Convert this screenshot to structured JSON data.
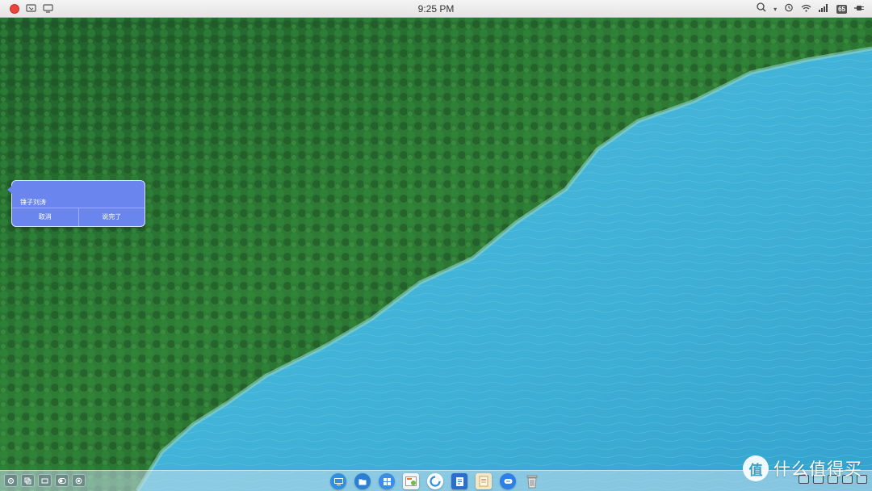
{
  "menubar": {
    "clock": "9:25 PM",
    "battery_label": "65",
    "left_icons": [
      "close-dot-icon",
      "screenshot-icon",
      "display-icon"
    ],
    "right_icons": [
      "search-icon",
      "chevron-down-icon",
      "alarm-icon",
      "wifi-icon",
      "signal-icon",
      "battery-icon",
      "power-plug-icon"
    ]
  },
  "voice_popup": {
    "text": "锤子刘涛",
    "cancel_label": "取消",
    "done_label": "说完了",
    "bg_color": "#6a86ee"
  },
  "dock": {
    "left_tray_icons": [
      "settings-icon",
      "copy-icon",
      "window-icon",
      "toggle-icon",
      "record-icon"
    ],
    "apps": [
      "desktop-app-icon",
      "files-app-icon",
      "grid-apps-icon",
      "gallery-app-icon",
      "browser-app-icon",
      "document-app-icon",
      "notes-app-icon",
      "messages-app-icon",
      "trash-icon"
    ],
    "right_tray_icons": [
      "image-icon",
      "window-icon",
      "stack-icon",
      "list-icon",
      "menu-icon"
    ]
  },
  "watermark": {
    "logo_glyph": "值",
    "text": "什么值得买"
  }
}
